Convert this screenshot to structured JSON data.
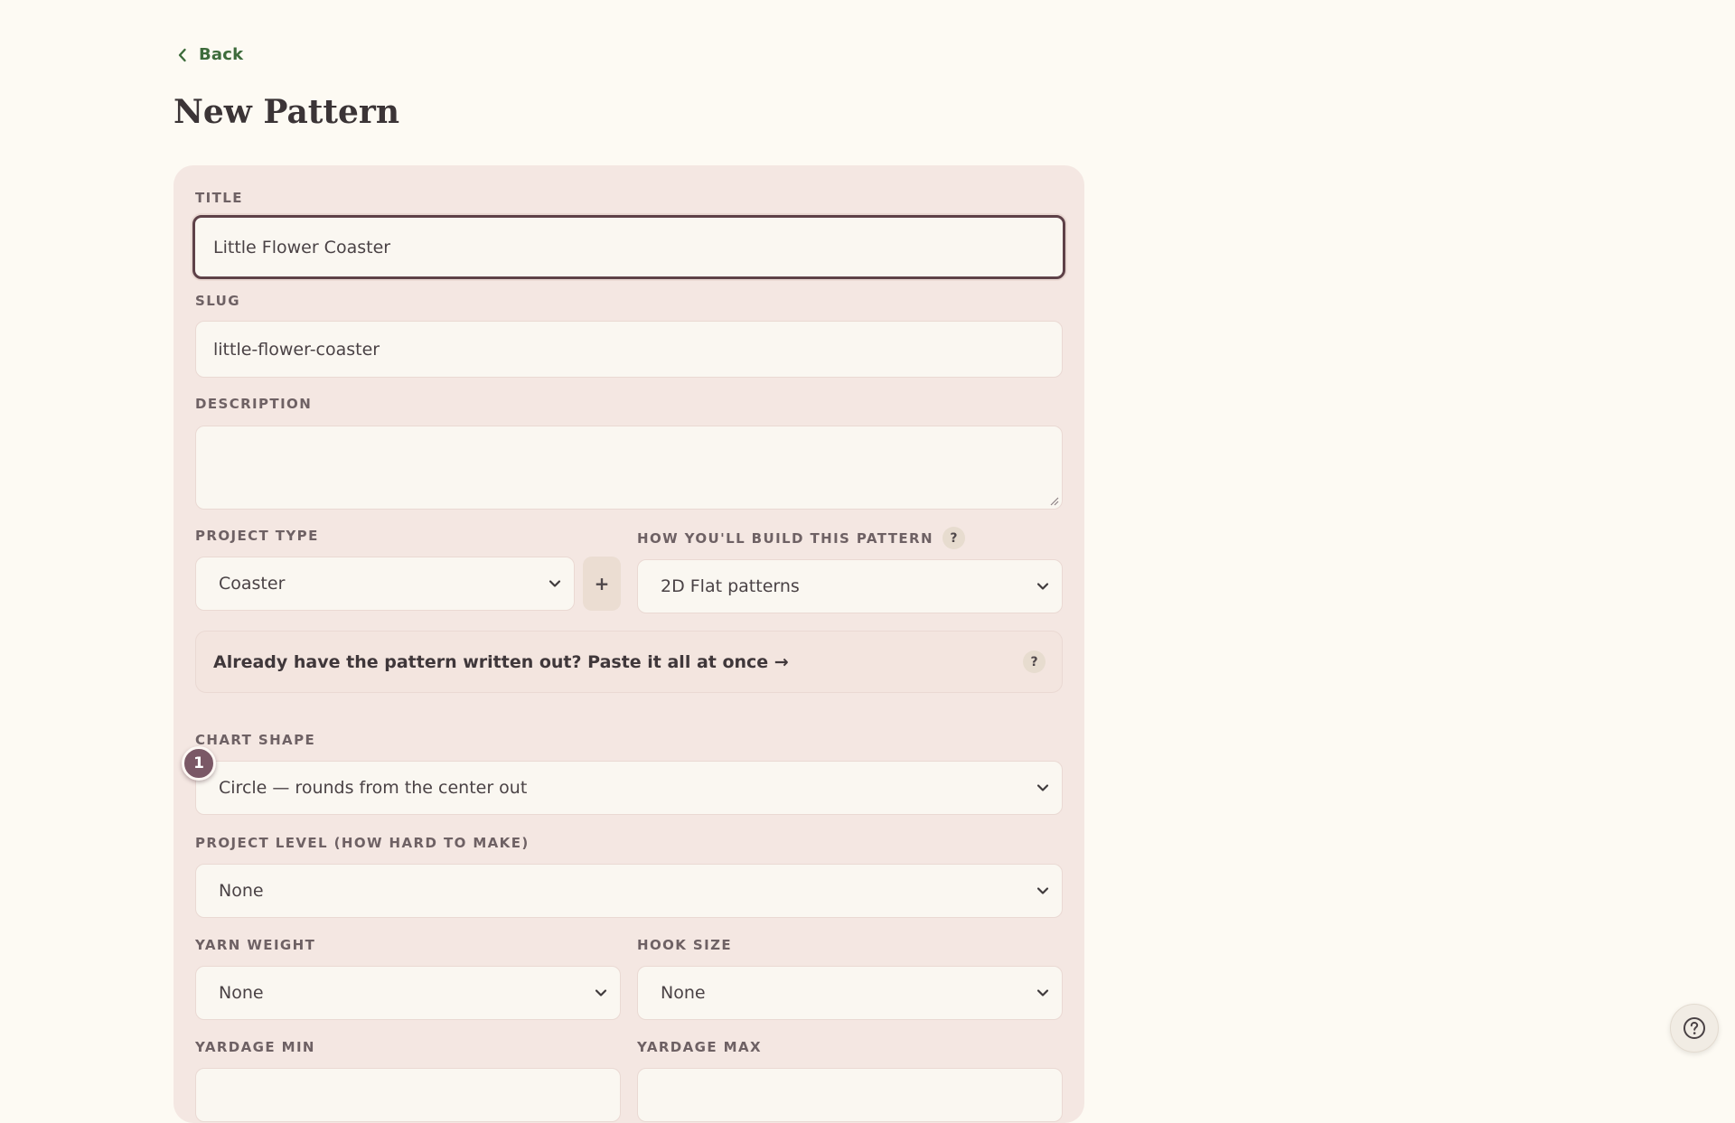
{
  "nav": {
    "back_label": "Back"
  },
  "page": {
    "title": "New Pattern"
  },
  "form": {
    "title": {
      "label": "TITLE",
      "value": "Little Flower Coaster"
    },
    "slug": {
      "label": "SLUG",
      "value": "little-flower-coaster"
    },
    "description": {
      "label": "DESCRIPTION",
      "value": ""
    },
    "project_type": {
      "label": "PROJECT TYPE",
      "value": "Coaster",
      "add_label": "+"
    },
    "build_method": {
      "label": "HOW YOU'LL BUILD THIS PATTERN",
      "help": "?",
      "value": "2D Flat patterns"
    },
    "paste_banner": {
      "text": "Already have the pattern written out? Paste it all at once →",
      "help": "?"
    },
    "chart_shape": {
      "label": "CHART SHAPE",
      "value": "Circle — rounds from the center out",
      "step_badge": "1"
    },
    "project_level": {
      "label": "PROJECT LEVEL (HOW HARD TO MAKE)",
      "value": "None"
    },
    "yarn_weight": {
      "label": "YARN WEIGHT",
      "value": "None"
    },
    "hook_size": {
      "label": "HOOK SIZE",
      "value": "None"
    },
    "yardage_min": {
      "label": "YARDAGE MIN",
      "value": ""
    },
    "yardage_max": {
      "label": "YARDAGE MAX",
      "value": ""
    }
  },
  "icons": {
    "back": "chevron-left-icon",
    "select": "chevron-down-icon",
    "help_fab": "question-circle-icon"
  },
  "colors": {
    "background": "#fdfaf3",
    "card": "#f4e7e2",
    "accent_green": "#3d6b3b",
    "focus_border": "#5e4148",
    "badge": "#7a5866"
  }
}
